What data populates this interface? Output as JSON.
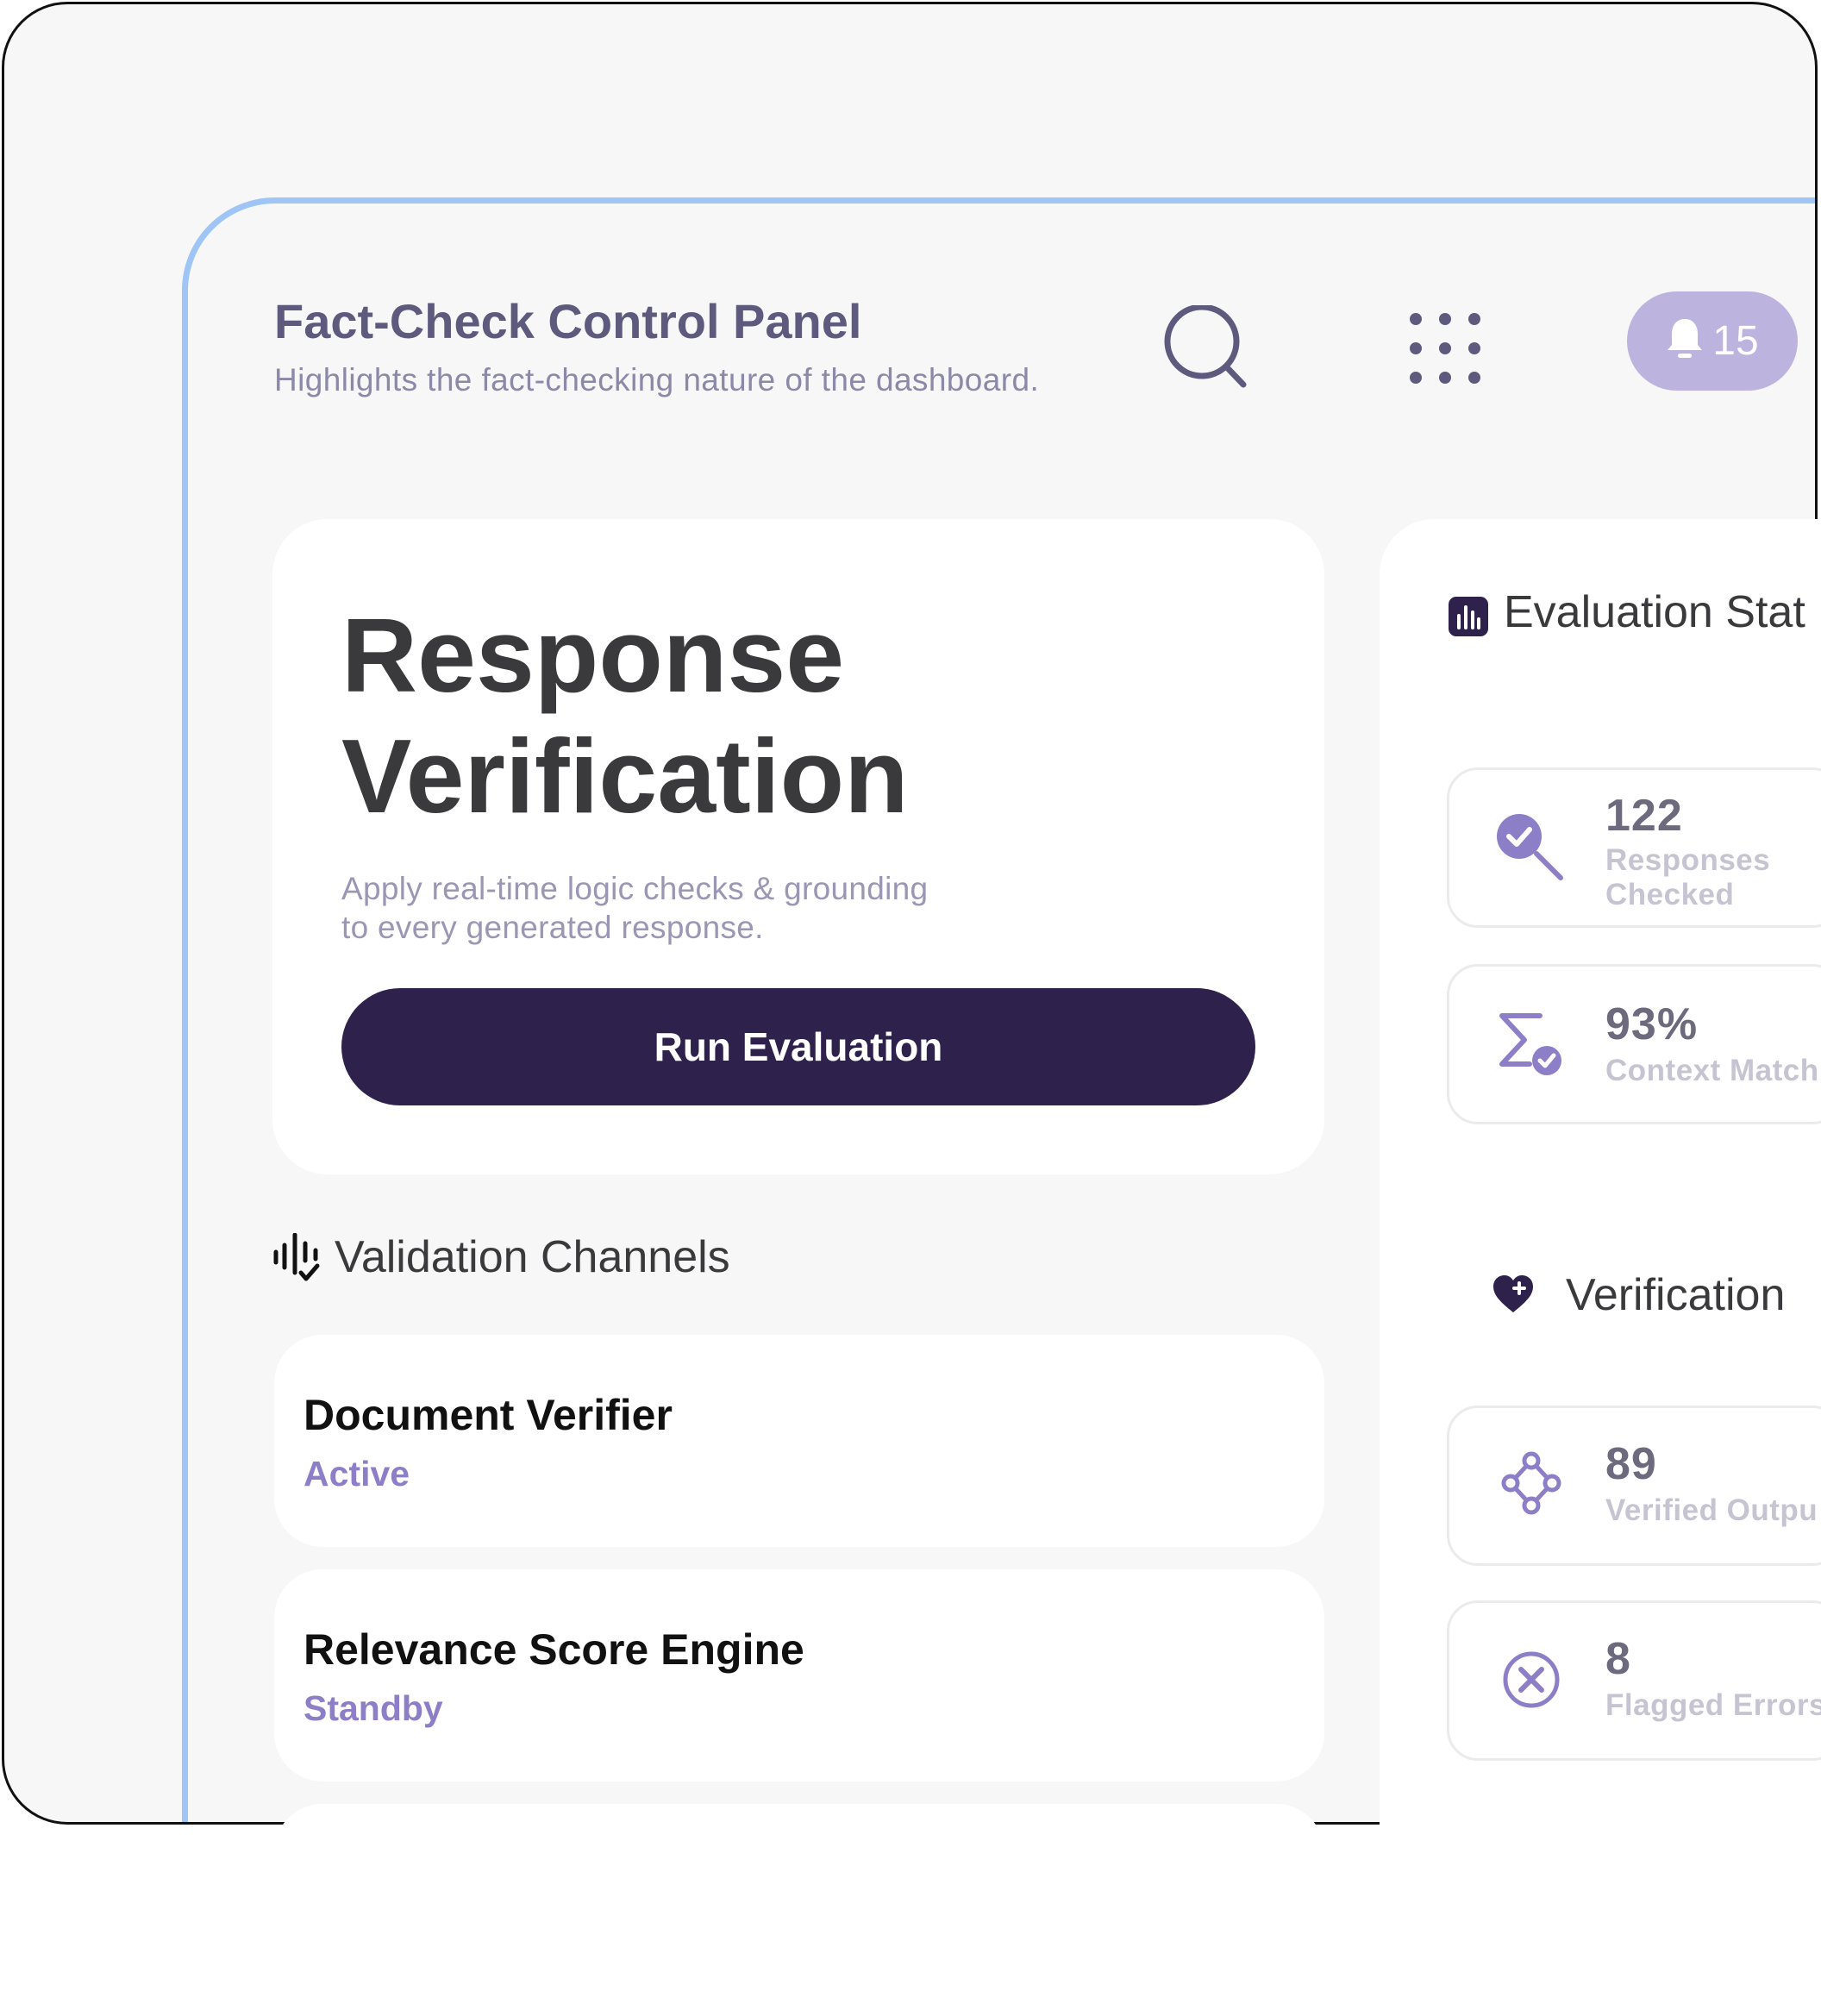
{
  "header": {
    "title": "Fact-Check Control Panel",
    "subtitle": "Highlights the fact-checking nature of the dashboard.",
    "notification_count": "15",
    "icons": [
      "search-icon",
      "apps-grid-icon",
      "bell-icon"
    ]
  },
  "hero": {
    "title_line1": "Response",
    "title_line2": "Verification",
    "desc_line1": "Apply real-time logic checks & grounding",
    "desc_line2": "to every generated response.",
    "button_label": "Run Evaluation"
  },
  "channels": {
    "title": "Validation Channels",
    "items": [
      {
        "name": "Document Verifier",
        "status": "Active"
      },
      {
        "name": "Relevance Score Engine",
        "status": "Standby"
      }
    ]
  },
  "stats": {
    "title": "Evaluation Stat",
    "items": [
      {
        "value": "122",
        "label_line1": "Responses",
        "label_line2": "Checked",
        "icon": "check-search-icon"
      },
      {
        "value": "93%",
        "label_line1": "Context Match",
        "icon": "sigma-check-icon"
      }
    ]
  },
  "verification": {
    "title": "Verification",
    "items": [
      {
        "value": "89",
        "label_line1": "Verified Outpu",
        "icon": "nodes-icon"
      },
      {
        "value": "8",
        "label_line1": "Flagged Errors",
        "icon": "x-circle-icon"
      }
    ]
  },
  "colors": {
    "accent": "#8d7fc7",
    "primary_button": "#2e224d",
    "notification_pill": "#bdb3df",
    "frame_border": "#9ec5f6",
    "title_text": "#5d5a7e"
  }
}
